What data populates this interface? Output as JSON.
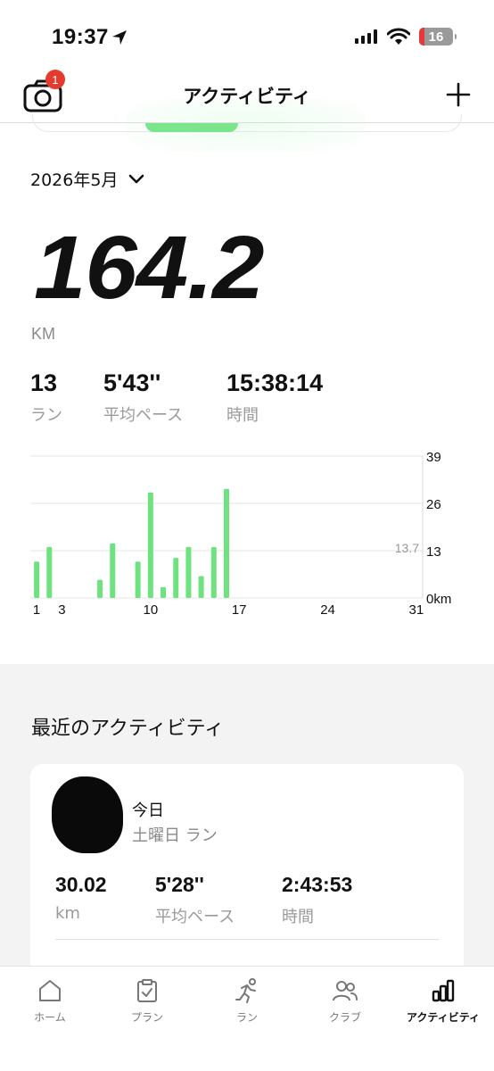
{
  "status_bar": {
    "time": "19:37",
    "battery": "16"
  },
  "header": {
    "title": "アクティビティ",
    "badge_count": "1"
  },
  "month_selector": {
    "label": "2026年5月"
  },
  "summary": {
    "distance": "164.2",
    "unit": "KM",
    "stats": [
      {
        "value": "13",
        "label": "ラン"
      },
      {
        "value": "5'43''",
        "label": "平均ペース"
      },
      {
        "value": "15:38:14",
        "label": "時間"
      }
    ]
  },
  "chart_data": {
    "type": "bar",
    "x": [
      1,
      2,
      6,
      7,
      9,
      10,
      11,
      12,
      13,
      14,
      15,
      16
    ],
    "values": [
      10,
      14,
      5,
      15,
      10,
      29,
      3,
      11,
      14,
      6,
      14,
      30
    ],
    "xlim": [
      1,
      31
    ],
    "x_ticks": [
      "1",
      "3",
      "10",
      "17",
      "24",
      "31"
    ],
    "ylim": [
      0,
      39
    ],
    "y_ticks": [
      "0km",
      "13",
      "26",
      "39"
    ],
    "average_label": "13.7",
    "color": "#6de27f"
  },
  "recent": {
    "title": "最近のアクティビティ",
    "card": {
      "date": "今日",
      "subtitle": "土曜日 ラン",
      "stats": [
        {
          "value": "30.02",
          "label": "km"
        },
        {
          "value": "5'28''",
          "label": "平均ペース"
        },
        {
          "value": "2:43:53",
          "label": "時間"
        }
      ]
    }
  },
  "tabbar": {
    "items": [
      {
        "label": "ホーム",
        "icon": "home-icon"
      },
      {
        "label": "プラン",
        "icon": "plan-icon"
      },
      {
        "label": "ラン",
        "icon": "run-icon"
      },
      {
        "label": "クラブ",
        "icon": "club-icon"
      },
      {
        "label": "アクティビティ",
        "icon": "activity-icon",
        "active": true
      }
    ]
  }
}
